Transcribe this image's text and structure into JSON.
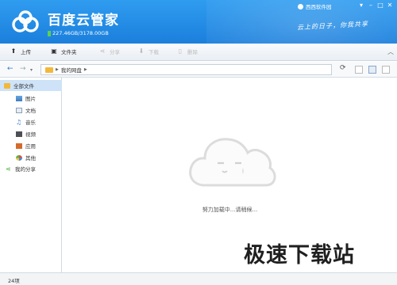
{
  "header": {
    "app_title": "百度云管家",
    "quota": "227.46GB/3178.00GB",
    "username": "西西软件园",
    "slogan": "云上的日子，你我共享",
    "colors": {
      "header_bg": "#1b7fdc",
      "quota_bar": "#5fd04c"
    }
  },
  "toolbar": {
    "upload": "上传",
    "new_folder": "文件夹",
    "share": "分享",
    "download": "下载",
    "delete": "删除"
  },
  "nav": {
    "breadcrumb": "我的网盘"
  },
  "sidebar": {
    "items": [
      {
        "label": "全部文件",
        "icon": "folder-icon",
        "selected": true
      },
      {
        "label": "图片",
        "icon": "image-icon",
        "selected": false
      },
      {
        "label": "文档",
        "icon": "document-icon",
        "selected": false
      },
      {
        "label": "音乐",
        "icon": "music-icon",
        "selected": false
      },
      {
        "label": "视频",
        "icon": "video-icon",
        "selected": false
      },
      {
        "label": "应用",
        "icon": "app-icon",
        "selected": false
      },
      {
        "label": "其他",
        "icon": "other-icon",
        "selected": false
      },
      {
        "label": "我的分享",
        "icon": "share-icon",
        "selected": false
      }
    ]
  },
  "main": {
    "loading_text": "努力加载中...请稍候...",
    "watermark": "极速下载站"
  },
  "statusbar": {
    "count": "24项"
  }
}
